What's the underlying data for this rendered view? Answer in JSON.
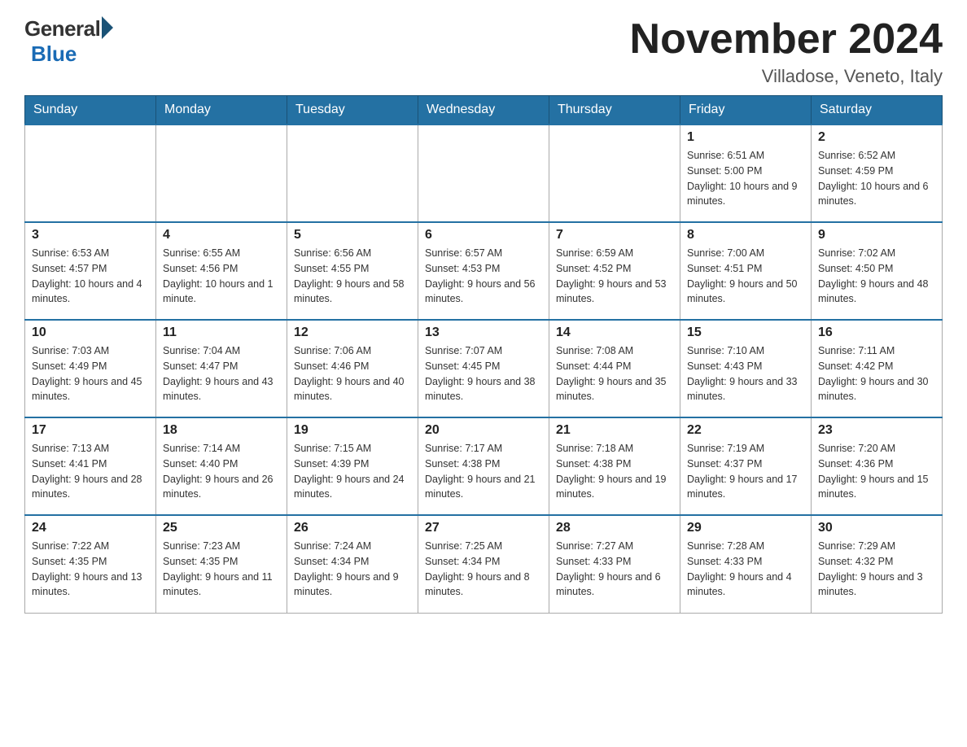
{
  "logo": {
    "general": "General",
    "blue": "Blue"
  },
  "title": "November 2024",
  "location": "Villadose, Veneto, Italy",
  "days_of_week": [
    "Sunday",
    "Monday",
    "Tuesday",
    "Wednesday",
    "Thursday",
    "Friday",
    "Saturday"
  ],
  "weeks": [
    [
      {
        "day": "",
        "info": ""
      },
      {
        "day": "",
        "info": ""
      },
      {
        "day": "",
        "info": ""
      },
      {
        "day": "",
        "info": ""
      },
      {
        "day": "",
        "info": ""
      },
      {
        "day": "1",
        "info": "Sunrise: 6:51 AM\nSunset: 5:00 PM\nDaylight: 10 hours and 9 minutes."
      },
      {
        "day": "2",
        "info": "Sunrise: 6:52 AM\nSunset: 4:59 PM\nDaylight: 10 hours and 6 minutes."
      }
    ],
    [
      {
        "day": "3",
        "info": "Sunrise: 6:53 AM\nSunset: 4:57 PM\nDaylight: 10 hours and 4 minutes."
      },
      {
        "day": "4",
        "info": "Sunrise: 6:55 AM\nSunset: 4:56 PM\nDaylight: 10 hours and 1 minute."
      },
      {
        "day": "5",
        "info": "Sunrise: 6:56 AM\nSunset: 4:55 PM\nDaylight: 9 hours and 58 minutes."
      },
      {
        "day": "6",
        "info": "Sunrise: 6:57 AM\nSunset: 4:53 PM\nDaylight: 9 hours and 56 minutes."
      },
      {
        "day": "7",
        "info": "Sunrise: 6:59 AM\nSunset: 4:52 PM\nDaylight: 9 hours and 53 minutes."
      },
      {
        "day": "8",
        "info": "Sunrise: 7:00 AM\nSunset: 4:51 PM\nDaylight: 9 hours and 50 minutes."
      },
      {
        "day": "9",
        "info": "Sunrise: 7:02 AM\nSunset: 4:50 PM\nDaylight: 9 hours and 48 minutes."
      }
    ],
    [
      {
        "day": "10",
        "info": "Sunrise: 7:03 AM\nSunset: 4:49 PM\nDaylight: 9 hours and 45 minutes."
      },
      {
        "day": "11",
        "info": "Sunrise: 7:04 AM\nSunset: 4:47 PM\nDaylight: 9 hours and 43 minutes."
      },
      {
        "day": "12",
        "info": "Sunrise: 7:06 AM\nSunset: 4:46 PM\nDaylight: 9 hours and 40 minutes."
      },
      {
        "day": "13",
        "info": "Sunrise: 7:07 AM\nSunset: 4:45 PM\nDaylight: 9 hours and 38 minutes."
      },
      {
        "day": "14",
        "info": "Sunrise: 7:08 AM\nSunset: 4:44 PM\nDaylight: 9 hours and 35 minutes."
      },
      {
        "day": "15",
        "info": "Sunrise: 7:10 AM\nSunset: 4:43 PM\nDaylight: 9 hours and 33 minutes."
      },
      {
        "day": "16",
        "info": "Sunrise: 7:11 AM\nSunset: 4:42 PM\nDaylight: 9 hours and 30 minutes."
      }
    ],
    [
      {
        "day": "17",
        "info": "Sunrise: 7:13 AM\nSunset: 4:41 PM\nDaylight: 9 hours and 28 minutes."
      },
      {
        "day": "18",
        "info": "Sunrise: 7:14 AM\nSunset: 4:40 PM\nDaylight: 9 hours and 26 minutes."
      },
      {
        "day": "19",
        "info": "Sunrise: 7:15 AM\nSunset: 4:39 PM\nDaylight: 9 hours and 24 minutes."
      },
      {
        "day": "20",
        "info": "Sunrise: 7:17 AM\nSunset: 4:38 PM\nDaylight: 9 hours and 21 minutes."
      },
      {
        "day": "21",
        "info": "Sunrise: 7:18 AM\nSunset: 4:38 PM\nDaylight: 9 hours and 19 minutes."
      },
      {
        "day": "22",
        "info": "Sunrise: 7:19 AM\nSunset: 4:37 PM\nDaylight: 9 hours and 17 minutes."
      },
      {
        "day": "23",
        "info": "Sunrise: 7:20 AM\nSunset: 4:36 PM\nDaylight: 9 hours and 15 minutes."
      }
    ],
    [
      {
        "day": "24",
        "info": "Sunrise: 7:22 AM\nSunset: 4:35 PM\nDaylight: 9 hours and 13 minutes."
      },
      {
        "day": "25",
        "info": "Sunrise: 7:23 AM\nSunset: 4:35 PM\nDaylight: 9 hours and 11 minutes."
      },
      {
        "day": "26",
        "info": "Sunrise: 7:24 AM\nSunset: 4:34 PM\nDaylight: 9 hours and 9 minutes."
      },
      {
        "day": "27",
        "info": "Sunrise: 7:25 AM\nSunset: 4:34 PM\nDaylight: 9 hours and 8 minutes."
      },
      {
        "day": "28",
        "info": "Sunrise: 7:27 AM\nSunset: 4:33 PM\nDaylight: 9 hours and 6 minutes."
      },
      {
        "day": "29",
        "info": "Sunrise: 7:28 AM\nSunset: 4:33 PM\nDaylight: 9 hours and 4 minutes."
      },
      {
        "day": "30",
        "info": "Sunrise: 7:29 AM\nSunset: 4:32 PM\nDaylight: 9 hours and 3 minutes."
      }
    ]
  ]
}
